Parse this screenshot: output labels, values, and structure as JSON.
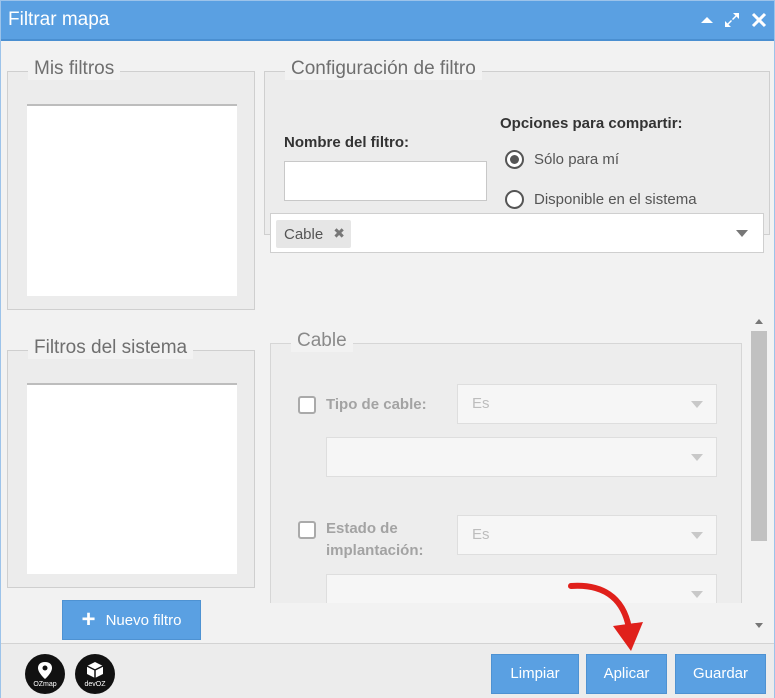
{
  "window": {
    "title": "Filtrar mapa"
  },
  "my_filters": {
    "legend": "Mis filtros"
  },
  "system_filters": {
    "legend": "Filtros del sistema"
  },
  "config": {
    "legend": "Configuración de filtro",
    "name_label": "Nombre del filtro:",
    "name_value": "",
    "share_label": "Opciones para compartir:",
    "share_options": [
      {
        "label": "Sólo para mí",
        "selected": true
      },
      {
        "label": "Disponible en el sistema",
        "selected": false
      }
    ]
  },
  "type_select": {
    "tags": [
      "Cable"
    ]
  },
  "cable": {
    "legend": "Cable",
    "fields": [
      {
        "label": "Tipo de cable:",
        "operator": "Es",
        "value": ""
      },
      {
        "label_line1": "Estado de",
        "label_line2": "implantación:",
        "operator": "Es",
        "value": ""
      }
    ]
  },
  "buttons": {
    "new_filter": "Nuevo filtro",
    "clear": "Limpiar",
    "apply": "Aplicar",
    "save": "Guardar"
  },
  "logos": {
    "ozmap": "OZmap",
    "devoz": "devOZ"
  },
  "colors": {
    "accent": "#5aa0e2",
    "annotation": "#e0201b"
  }
}
